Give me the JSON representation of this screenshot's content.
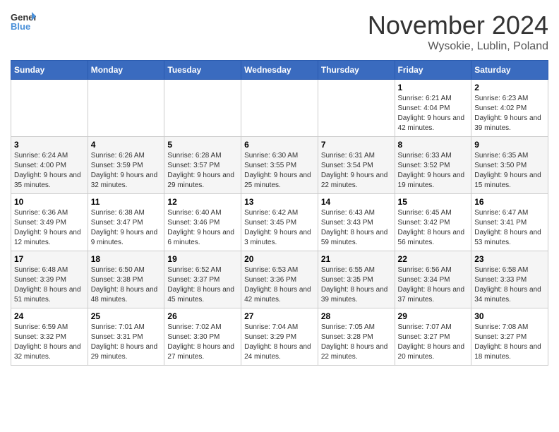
{
  "header": {
    "logo_line1": "General",
    "logo_line2": "Blue",
    "month_title": "November 2024",
    "location": "Wysokie, Lublin, Poland"
  },
  "days_of_week": [
    "Sunday",
    "Monday",
    "Tuesday",
    "Wednesday",
    "Thursday",
    "Friday",
    "Saturday"
  ],
  "weeks": [
    [
      {
        "day": "",
        "info": ""
      },
      {
        "day": "",
        "info": ""
      },
      {
        "day": "",
        "info": ""
      },
      {
        "day": "",
        "info": ""
      },
      {
        "day": "",
        "info": ""
      },
      {
        "day": "1",
        "info": "Sunrise: 6:21 AM\nSunset: 4:04 PM\nDaylight: 9 hours and 42 minutes."
      },
      {
        "day": "2",
        "info": "Sunrise: 6:23 AM\nSunset: 4:02 PM\nDaylight: 9 hours and 39 minutes."
      }
    ],
    [
      {
        "day": "3",
        "info": "Sunrise: 6:24 AM\nSunset: 4:00 PM\nDaylight: 9 hours and 35 minutes."
      },
      {
        "day": "4",
        "info": "Sunrise: 6:26 AM\nSunset: 3:59 PM\nDaylight: 9 hours and 32 minutes."
      },
      {
        "day": "5",
        "info": "Sunrise: 6:28 AM\nSunset: 3:57 PM\nDaylight: 9 hours and 29 minutes."
      },
      {
        "day": "6",
        "info": "Sunrise: 6:30 AM\nSunset: 3:55 PM\nDaylight: 9 hours and 25 minutes."
      },
      {
        "day": "7",
        "info": "Sunrise: 6:31 AM\nSunset: 3:54 PM\nDaylight: 9 hours and 22 minutes."
      },
      {
        "day": "8",
        "info": "Sunrise: 6:33 AM\nSunset: 3:52 PM\nDaylight: 9 hours and 19 minutes."
      },
      {
        "day": "9",
        "info": "Sunrise: 6:35 AM\nSunset: 3:50 PM\nDaylight: 9 hours and 15 minutes."
      }
    ],
    [
      {
        "day": "10",
        "info": "Sunrise: 6:36 AM\nSunset: 3:49 PM\nDaylight: 9 hours and 12 minutes."
      },
      {
        "day": "11",
        "info": "Sunrise: 6:38 AM\nSunset: 3:47 PM\nDaylight: 9 hours and 9 minutes."
      },
      {
        "day": "12",
        "info": "Sunrise: 6:40 AM\nSunset: 3:46 PM\nDaylight: 9 hours and 6 minutes."
      },
      {
        "day": "13",
        "info": "Sunrise: 6:42 AM\nSunset: 3:45 PM\nDaylight: 9 hours and 3 minutes."
      },
      {
        "day": "14",
        "info": "Sunrise: 6:43 AM\nSunset: 3:43 PM\nDaylight: 8 hours and 59 minutes."
      },
      {
        "day": "15",
        "info": "Sunrise: 6:45 AM\nSunset: 3:42 PM\nDaylight: 8 hours and 56 minutes."
      },
      {
        "day": "16",
        "info": "Sunrise: 6:47 AM\nSunset: 3:41 PM\nDaylight: 8 hours and 53 minutes."
      }
    ],
    [
      {
        "day": "17",
        "info": "Sunrise: 6:48 AM\nSunset: 3:39 PM\nDaylight: 8 hours and 51 minutes."
      },
      {
        "day": "18",
        "info": "Sunrise: 6:50 AM\nSunset: 3:38 PM\nDaylight: 8 hours and 48 minutes."
      },
      {
        "day": "19",
        "info": "Sunrise: 6:52 AM\nSunset: 3:37 PM\nDaylight: 8 hours and 45 minutes."
      },
      {
        "day": "20",
        "info": "Sunrise: 6:53 AM\nSunset: 3:36 PM\nDaylight: 8 hours and 42 minutes."
      },
      {
        "day": "21",
        "info": "Sunrise: 6:55 AM\nSunset: 3:35 PM\nDaylight: 8 hours and 39 minutes."
      },
      {
        "day": "22",
        "info": "Sunrise: 6:56 AM\nSunset: 3:34 PM\nDaylight: 8 hours and 37 minutes."
      },
      {
        "day": "23",
        "info": "Sunrise: 6:58 AM\nSunset: 3:33 PM\nDaylight: 8 hours and 34 minutes."
      }
    ],
    [
      {
        "day": "24",
        "info": "Sunrise: 6:59 AM\nSunset: 3:32 PM\nDaylight: 8 hours and 32 minutes."
      },
      {
        "day": "25",
        "info": "Sunrise: 7:01 AM\nSunset: 3:31 PM\nDaylight: 8 hours and 29 minutes."
      },
      {
        "day": "26",
        "info": "Sunrise: 7:02 AM\nSunset: 3:30 PM\nDaylight: 8 hours and 27 minutes."
      },
      {
        "day": "27",
        "info": "Sunrise: 7:04 AM\nSunset: 3:29 PM\nDaylight: 8 hours and 24 minutes."
      },
      {
        "day": "28",
        "info": "Sunrise: 7:05 AM\nSunset: 3:28 PM\nDaylight: 8 hours and 22 minutes."
      },
      {
        "day": "29",
        "info": "Sunrise: 7:07 AM\nSunset: 3:27 PM\nDaylight: 8 hours and 20 minutes."
      },
      {
        "day": "30",
        "info": "Sunrise: 7:08 AM\nSunset: 3:27 PM\nDaylight: 8 hours and 18 minutes."
      }
    ]
  ]
}
